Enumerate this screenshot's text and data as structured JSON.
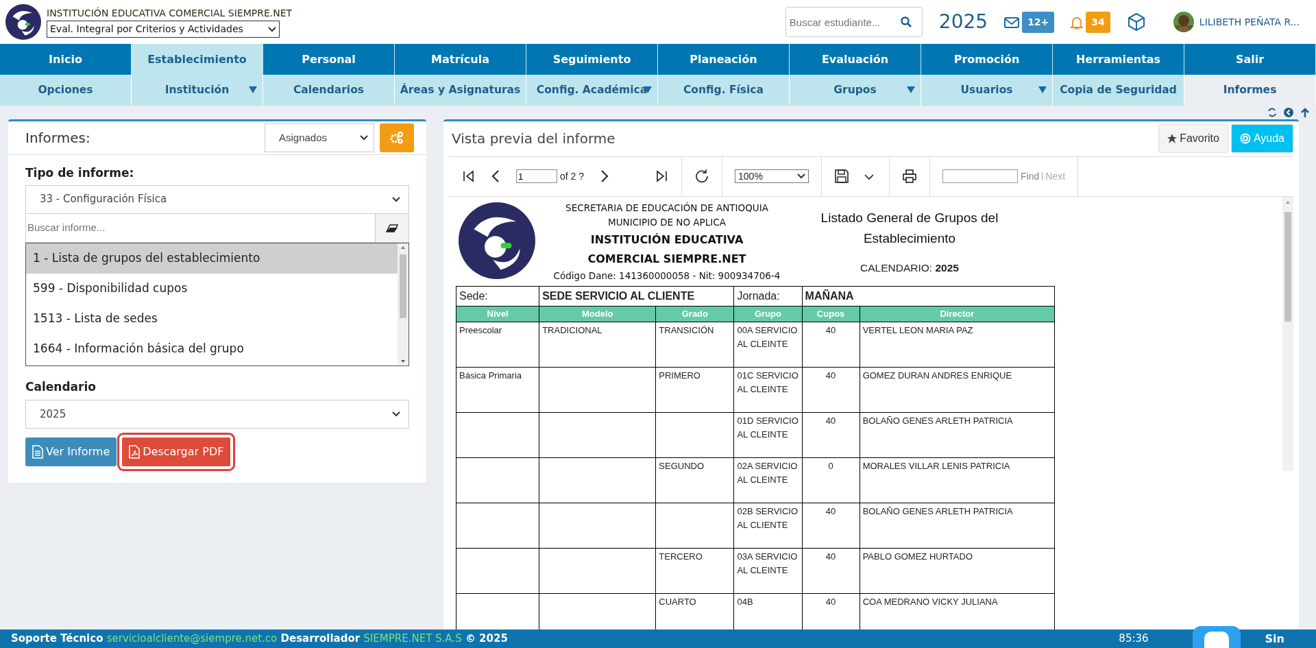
{
  "header": {
    "school_name": "INSTITUCIÓN EDUCATIVA COMERCIAL SIEMPRE.NET",
    "mode_select": "Eval. Integral por Criterios y Actividades",
    "search": {
      "placeholder": "Buscar estudiante..."
    },
    "year": "2025",
    "messages_count": "12+",
    "notifications_count": "34",
    "user_name": "LILIBETH PEÑATA R..."
  },
  "menu": [
    {
      "label": "Inicio",
      "selected": false
    },
    {
      "label": "Establecimiento",
      "selected": true
    },
    {
      "label": "Personal",
      "selected": false
    },
    {
      "label": "Matrícula",
      "selected": false
    },
    {
      "label": "Seguimiento",
      "selected": false
    },
    {
      "label": "Planeación",
      "selected": false
    },
    {
      "label": "Evaluación",
      "selected": false
    },
    {
      "label": "Promoción",
      "selected": false
    },
    {
      "label": "Herramientas",
      "selected": false
    },
    {
      "label": "Salir",
      "selected": false
    }
  ],
  "submenu": [
    {
      "label": "Opciones",
      "selected": false,
      "dropdown": false
    },
    {
      "label": "Institución",
      "selected": false,
      "dropdown": true
    },
    {
      "label": "Calendarios",
      "selected": false,
      "dropdown": false
    },
    {
      "label": "Áreas y Asignaturas",
      "selected": false,
      "dropdown": false
    },
    {
      "label": "Config. Académica",
      "selected": false,
      "dropdown": true
    },
    {
      "label": "Config. Física",
      "selected": false,
      "dropdown": false
    },
    {
      "label": "Grupos",
      "selected": false,
      "dropdown": true
    },
    {
      "label": "Usuarios",
      "selected": false,
      "dropdown": true
    },
    {
      "label": "Copia de Seguridad",
      "selected": false,
      "dropdown": false
    },
    {
      "label": "Informes",
      "selected": true,
      "dropdown": false
    }
  ],
  "left_panel": {
    "title": "Informes:",
    "filter": "Asignados",
    "type_label": "Tipo de informe:",
    "type_select": "33 - Configuración Física",
    "report_search": {
      "placeholder": "Buscar informe..."
    },
    "reports": [
      {
        "label": "1 - Lista de grupos del establecimiento",
        "selected": true
      },
      {
        "label": "599 - Disponibilidad cupos",
        "selected": false
      },
      {
        "label": "1513 - Lista de sedes",
        "selected": false
      },
      {
        "label": "1664 - Información básica del grupo",
        "selected": false
      }
    ],
    "calendar_label": "Calendario",
    "calendar": "2025",
    "buttons": [
      {
        "label": "Ver Informe",
        "kind": "view",
        "highlighted": false
      },
      {
        "label": "Descargar PDF",
        "kind": "pdf",
        "highlighted": true
      }
    ]
  },
  "preview": {
    "title": "Vista previa del informe",
    "buttons": [
      {
        "label": "Favorito",
        "kind": "favorite"
      },
      {
        "label": "Ayuda",
        "kind": "help"
      }
    ],
    "toolbar": {
      "page": "1",
      "page_count": "of 2 ?",
      "zoom": "100%",
      "find": "Find",
      "next": "Next"
    },
    "report": {
      "header_lines": [
        "SECRETARIA DE EDUCACIÓN DE ANTIOQUIA",
        "MUNICIPIO DE NO APLICA"
      ],
      "institution": "INSTITUCIÓN EDUCATIVA COMERCIAL SIEMPRE.NET",
      "codes": "Código Dane: 141360000058 - Nit: 900934706-4",
      "title": "Listado General de Grupos del Establecimiento",
      "calendar_label": "CALENDARIO:",
      "calendar_value": "2025",
      "sede_label": "Sede:",
      "sede_value": "SEDE SERVICIO AL CLIENTE",
      "jornada_label": "Jornada:",
      "jornada_value": "MAÑANA",
      "columns": [
        "Nivel",
        "Modelo",
        "Grado",
        "Grupo",
        "Cupos",
        "Director"
      ],
      "rows": [
        [
          "Preescolar",
          "TRADICIONAL",
          "TRANSICIÓN",
          "00A SERVICIO AL CLEINTE",
          "40",
          "VERTEL LEON MARIA  PAZ"
        ],
        [
          "Básica Primaria",
          "",
          "PRIMERO",
          "01C SERVICIO AL CLEINTE",
          "40",
          "GOMEZ DURAN ANDRES ENRIQUE"
        ],
        [
          "",
          "",
          "",
          "01D SERVICIO AL CLEINTE",
          "40",
          "BOLAÑO GENES ARLETH PATRICIA"
        ],
        [
          "",
          "",
          "SEGUNDO",
          "02A SERVICIO AL CLEINTE",
          "0",
          "MORALES VILLAR LENIS PATRICIA"
        ],
        [
          "",
          "",
          "",
          "02B SERVICIO AL CLIENTE",
          "40",
          "BOLAÑO GENES ARLETH PATRICIA"
        ],
        [
          "",
          "",
          "TERCERO",
          "03A SERVICIO AL CLEINTE",
          "40",
          "PABLO GOMEZ HURTADO"
        ],
        [
          "",
          "",
          "CUARTO",
          "04B",
          "40",
          "COA MEDRANO VICKY JULIANA"
        ]
      ]
    }
  },
  "footer": {
    "support_label": "Soporte Técnico",
    "support_email": "servicioalcliente@siempre.net.co",
    "developer_label": "Desarrollador",
    "developer": "SIEMPRE.NET S.A.S",
    "copyright": "© 2025",
    "timer": "85:36",
    "brand": "Sin"
  }
}
